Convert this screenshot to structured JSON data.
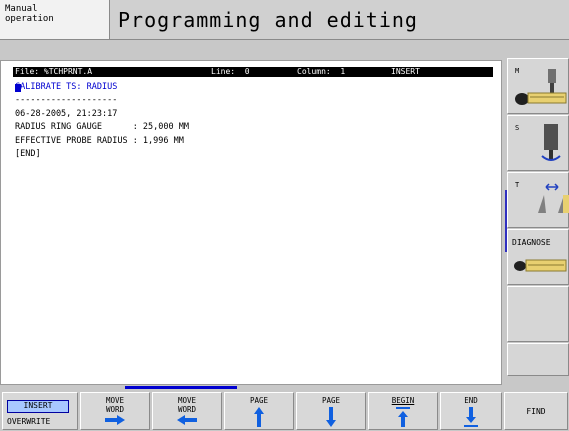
{
  "header": {
    "mode_line1": "Manual",
    "mode_line2": "operation",
    "title": "Programming and editing"
  },
  "editor": {
    "status": {
      "file": "File: %TCHPRNT.A",
      "line": "Line:  0",
      "column": "Column:  1",
      "mode": "INSERT"
    },
    "lines": [
      "CALIBRATE TS: RADIUS",
      "--------------------",
      "06-28-2005, 21:23:17",
      "RADIUS RING GAUGE      : 25,000 MM",
      "EFFECTIVE PROBE RADIUS : 1,996 MM",
      "[END]"
    ]
  },
  "right_softkeys": {
    "m": "M",
    "s": "S",
    "t": "T",
    "diagnose": "DIAGNOSE"
  },
  "bottom_softkeys": {
    "insert": "INSERT",
    "overwrite": "OVERWRITE",
    "move_word_right_1": "MOVE",
    "move_word_right_2": "WORD",
    "move_word_left_1": "MOVE",
    "move_word_left_2": "WORD",
    "page_up": "PAGE",
    "page_down": "PAGE",
    "begin": "BEGIN",
    "end": "END",
    "find": "FIND"
  },
  "colors": {
    "accent_blue": "#0000d0",
    "insert_bg": "#a8c8ff"
  }
}
